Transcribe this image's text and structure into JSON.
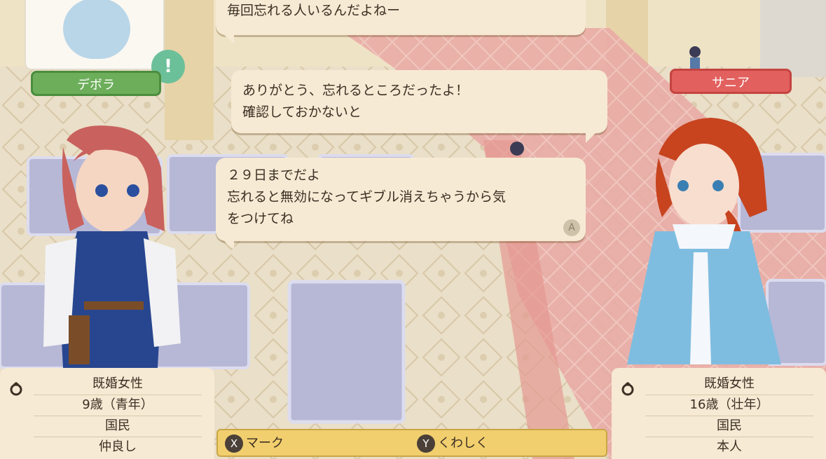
{
  "top_left": {
    "name": "デボラ",
    "alert_symbol": "!"
  },
  "top_right": {
    "name": "サニア"
  },
  "dialogue": {
    "line1": "毎回忘れる人いるんだよねー",
    "line2a": "ありがとう、忘れるところだったよ！",
    "line2b": "確認しておかないと",
    "line3a": "２９日までだよ",
    "line3b": "忘れると無効になってギブル消えちゃうから気",
    "line3c": "をつけてね",
    "advance_key": "A"
  },
  "left_card": {
    "rows": [
      "既婚女性",
      "9歳（青年）",
      "国民",
      "仲良し"
    ]
  },
  "right_card": {
    "rows": [
      "既婚女性",
      "16歳（壮年）",
      "国民",
      "本人"
    ]
  },
  "controls": {
    "mark_key": "X",
    "mark_label": "マーク",
    "details_key": "Y",
    "details_label": "くわしく"
  },
  "colors": {
    "bubble": "#f6ead4",
    "left_nameplate": "#6cae5a",
    "right_nameplate": "#e2605e",
    "button_bar": "#f2cf6e"
  }
}
